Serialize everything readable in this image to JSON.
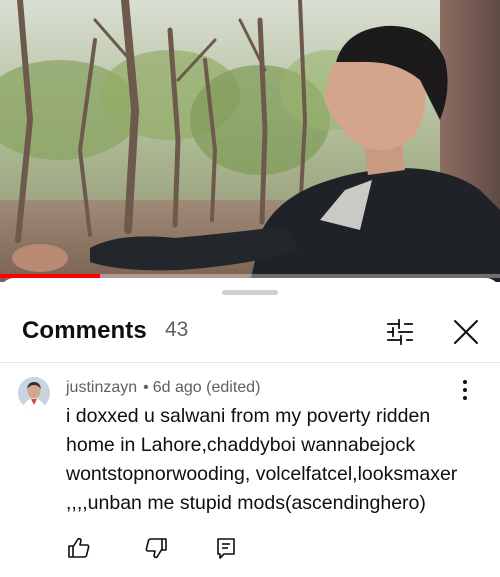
{
  "video": {
    "progress_fraction": 0.2,
    "accent_color": "#ff0000"
  },
  "comments_panel": {
    "title": "Comments",
    "count": "43",
    "icons": [
      "filter-sliders-icon",
      "close-icon"
    ]
  },
  "comment": {
    "author": "justinzayn",
    "separator": "•",
    "time": "6d ago (edited)",
    "text": "i doxxed u salwani from my poverty ridden\nhome in Lahore,chaddyboi wannabejock\nwontstopnorwooding, volcelfatcel,looksmaxer\n,,,,unban me stupid mods(ascendinghero)",
    "actions": [
      "like-icon",
      "dislike-icon",
      "reply-icon"
    ],
    "menu_icon": "more-vertical-icon"
  }
}
